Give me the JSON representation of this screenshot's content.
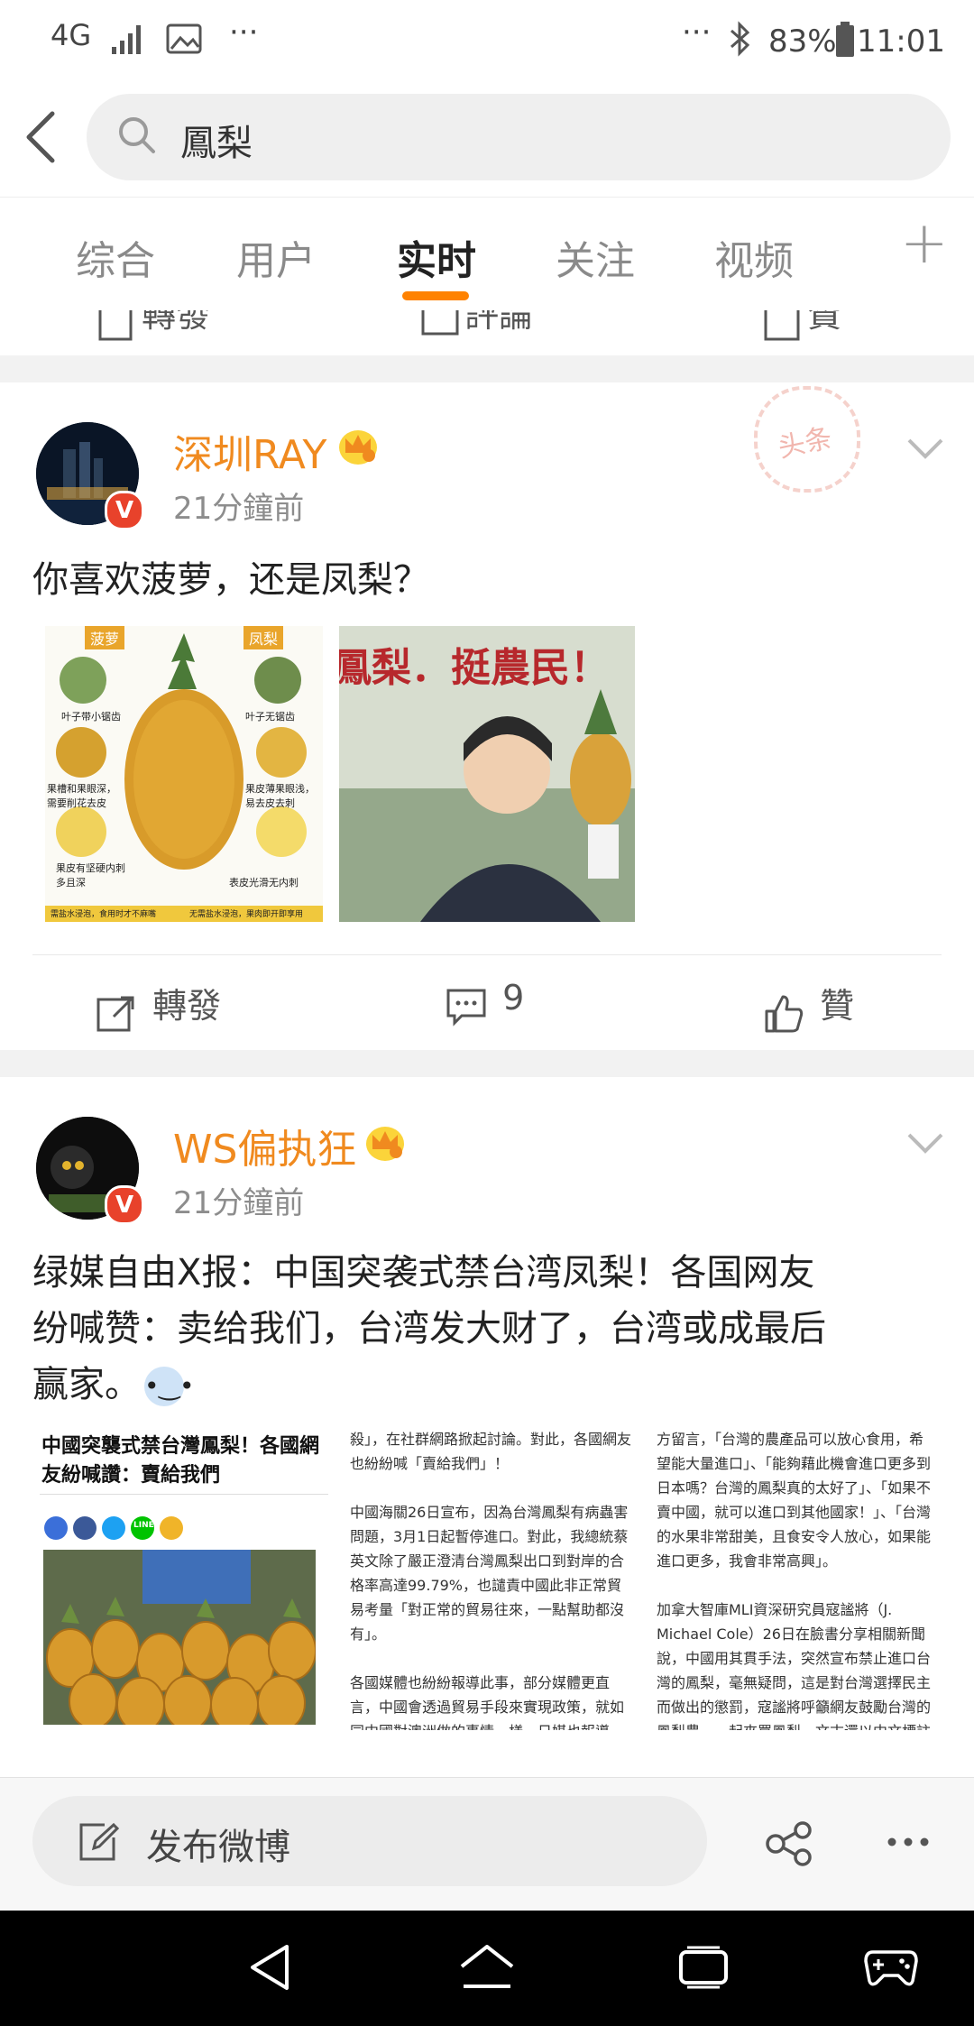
{
  "status_bar": {
    "network": "4G",
    "battery": "83%",
    "time": "11:01",
    "dots_left": "···",
    "dots_right": "···"
  },
  "search": {
    "query": "鳳梨"
  },
  "tabs": [
    {
      "label": "综合"
    },
    {
      "label": "用户"
    },
    {
      "label": "实时"
    },
    {
      "label": "关注"
    },
    {
      "label": "视频"
    }
  ],
  "tab_add": "+",
  "prev_post_actions": {
    "repost": "轉發",
    "comment": "評論",
    "like": "贊"
  },
  "posts": [
    {
      "username": "深圳RAY",
      "time": "21分鐘前",
      "text": "你喜欢菠萝，还是凤梨？",
      "stamp": "头条",
      "images": [
        {
          "left_title": "菠萝",
          "right_title": "凤梨",
          "label1": "叶子带小锯齿",
          "label2": "叶子无锯齿",
          "label3": "果槽和果眼深，需要削花去皮",
          "label4": "果皮薄果眼浅，易去皮去刺",
          "label5": "果皮有坚硬内刺多且深",
          "label6": "表皮光滑无内刺",
          "footer1": "需盐水浸泡，食用时才不麻嘴",
          "footer2": "无需盐水浸泡，果肉即开即享用"
        },
        {
          "banner": "鳳梨．挺農民！"
        }
      ],
      "actions": {
        "repost": "轉發",
        "comment": "9",
        "like": "贊"
      }
    },
    {
      "username": "WS偏执狂",
      "time": "21分鐘前",
      "text_line1": "绿媒自由X报：中国突袭式禁台湾凤梨！各国网友",
      "text_line2": "纷喊赞：卖给我们，台湾发大财了，台湾或成最后",
      "text_line3": "赢家。",
      "article": {
        "headline": "中國突襲式禁台灣鳳梨！各國網友紛喊讚：賣給我們",
        "col2": "殺」，在社群網路掀起討論。對此，各國網友也紛紛喊「賣給我們」！\n\n中國海關26日宣布，因為台灣鳳梨有病蟲害問題，3月1日起暫停進口。對此，我總統蔡英文除了嚴正澄清台灣鳳梨出口到對岸的合格率高達99.79%，也譴責中國此非正常貿易考量「對正常的貿易往來，一點幫助都沒有」。\n\n各國媒體也紛紛報導此事，部分媒體更直言，中國會透過貿易手段來實現政策，就如同中國對澳洲做的事情一樣。日媒也報導，",
        "col3": "方留言，「台灣的農產品可以放心食用，希望能大量進口」、「能夠藉此機會進口更多到日本嗎？台灣的鳳梨真的太好了」、「如果不賣中國，就可以進口到其他國家！」、「台灣的水果非常甜美，且食安令人放心，如果能進口更多，我會非常高興」。\n\n加拿大智庫MLI資深研究員寇謐將（J. Michael Cole）26日在臉書分享相關新聞說，中國用其貫手法，突然宣布禁止進口台灣的鳳梨，毫無疑問，這是對台灣選擇民主而做出的懲罰，寇謐將呼籲網友鼓勵台灣的鳳梨農，一起來買鳳梨，文末還以中文標註",
        "line_badge": "LINE"
      }
    }
  ],
  "bottom": {
    "compose_label": "发布微博"
  }
}
